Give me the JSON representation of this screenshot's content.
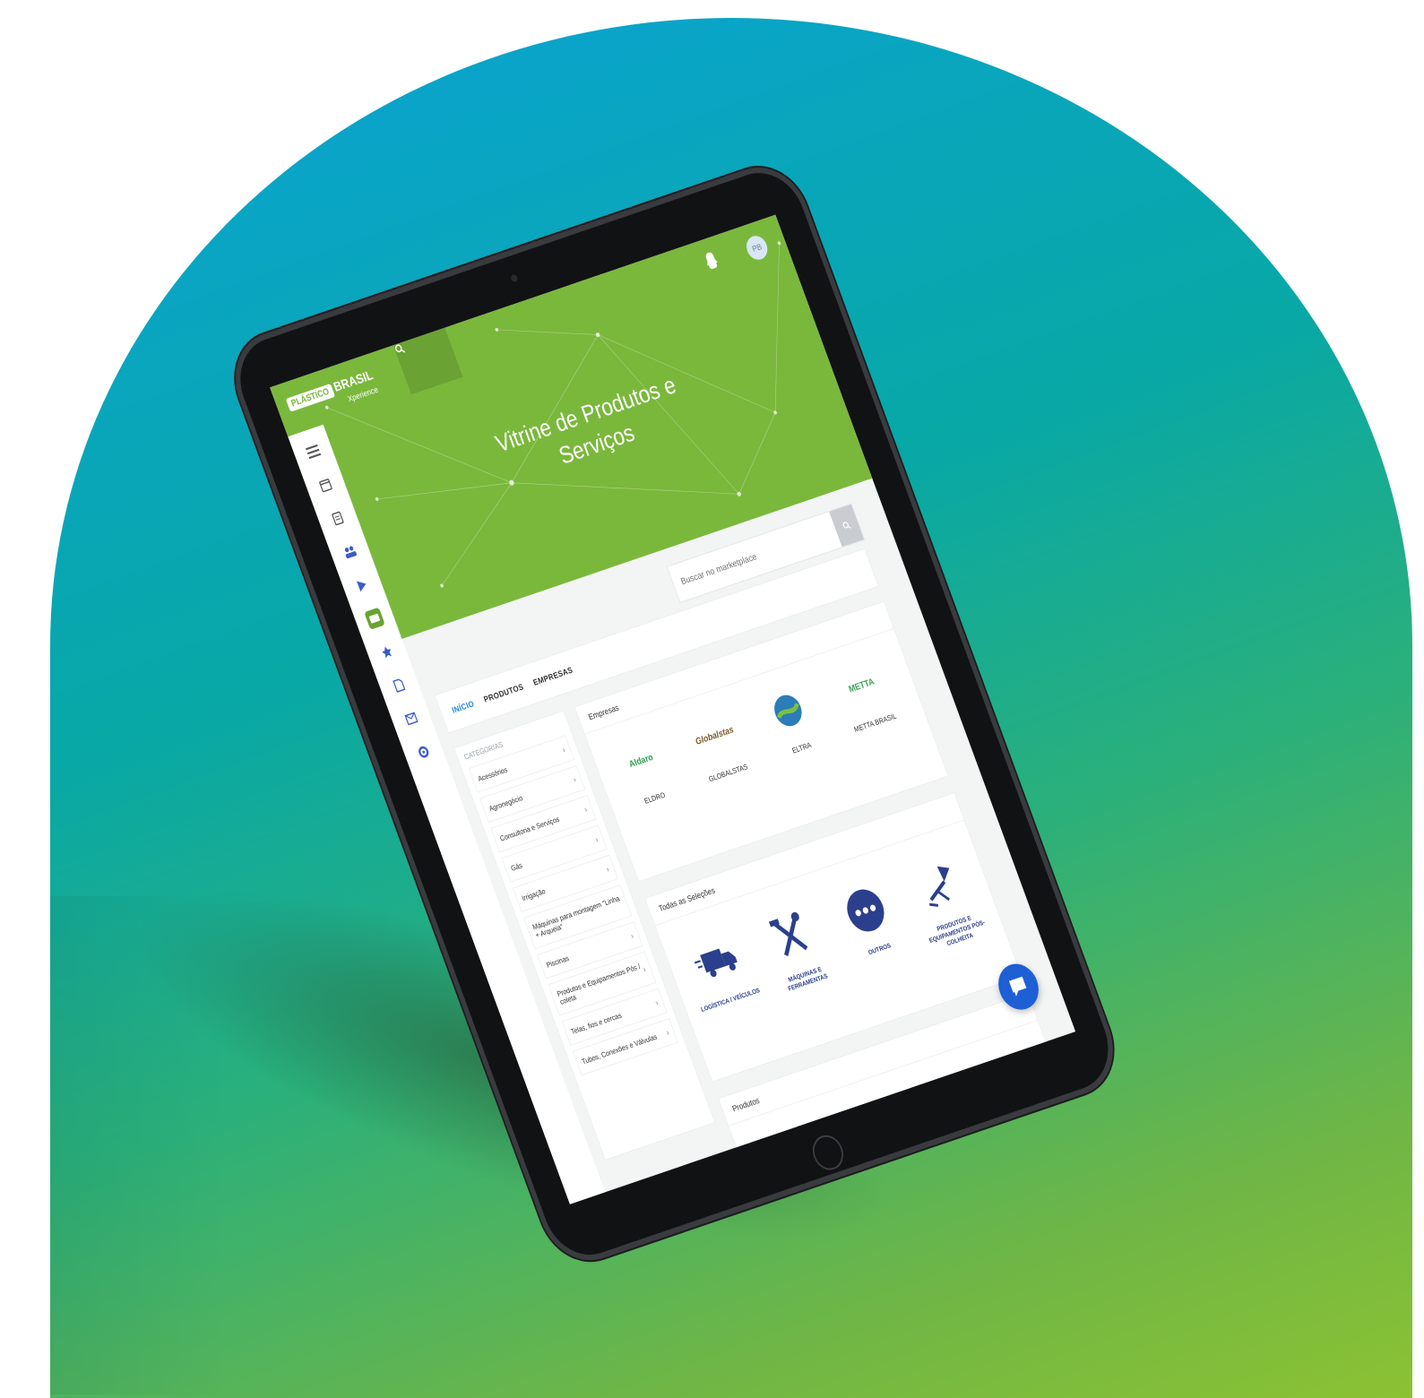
{
  "app": {
    "logo_badge": "PLÁSTICO",
    "logo_name": "BRASIL",
    "logo_sub": "Xperience"
  },
  "hero": {
    "title": "Vitrine de Produtos e Serviços",
    "accent_color": "#7ab83c"
  },
  "top_bar": {
    "avatar_initials": "PB"
  },
  "search": {
    "placeholder": "Buscar no marketplace"
  },
  "tabs": [
    {
      "label": "INÍCIO",
      "active": true
    },
    {
      "label": "PRODUTOS",
      "active": false
    },
    {
      "label": "EMPRESAS",
      "active": false
    }
  ],
  "sidebar": {
    "icons": [
      "menu-icon",
      "calendar-icon",
      "agenda-icon",
      "people-icon",
      "play-icon",
      "store-icon",
      "star-icon",
      "document-icon",
      "mail-icon",
      "settings-icon"
    ],
    "active_index": 5
  },
  "categories": {
    "title": "CATEGORIAS",
    "items": [
      {
        "label": "Acessórios",
        "has_children": true
      },
      {
        "label": "Agronegócio",
        "has_children": true
      },
      {
        "label": "Consultoria e Serviços",
        "has_children": true
      },
      {
        "label": "Gás",
        "has_children": true
      },
      {
        "label": "Irrigação",
        "has_children": true
      },
      {
        "label": "Máquinas para montagem \"Linha + Arqueia\"",
        "has_children": false
      },
      {
        "label": "Piscinas",
        "has_children": true
      },
      {
        "label": "Produtos e Equipamentos Pós / coleta",
        "has_children": true
      },
      {
        "label": "Telas, fios e cercas",
        "has_children": true
      },
      {
        "label": "Tubos, Conexões e Válvulas",
        "has_children": true
      }
    ]
  },
  "companies_card": {
    "title": "Empresas",
    "items": [
      {
        "name": "ELDRO",
        "logo_text": "Aldaro"
      },
      {
        "name": "GLOBALSTAS",
        "logo_text": "Globalstas"
      },
      {
        "name": "ELTRA",
        "logo_text": "ELTRA"
      },
      {
        "name": "METTA BRASIL",
        "logo_text": "METTA"
      }
    ]
  },
  "featured_card": {
    "title": "Todas as Seleções",
    "items": [
      {
        "label": "LOGÍSTICA / VEÍCULOS",
        "icon": "truck-icon"
      },
      {
        "label": "MÁQUINAS E FERRAMENTAS",
        "icon": "tools-icon"
      },
      {
        "label": "OUTROS",
        "icon": "more-icon"
      },
      {
        "label": "PRODUTOS E EQUIPAMENTOS PÓS-COLHEITA",
        "icon": "sprayer-icon"
      }
    ]
  },
  "products_card": {
    "title": "Produtos"
  },
  "colors": {
    "green": "#7ab83c",
    "dark_green": "#6aa233",
    "blue": "#1e5fd6",
    "icon_navy": "#2b3f8c"
  }
}
